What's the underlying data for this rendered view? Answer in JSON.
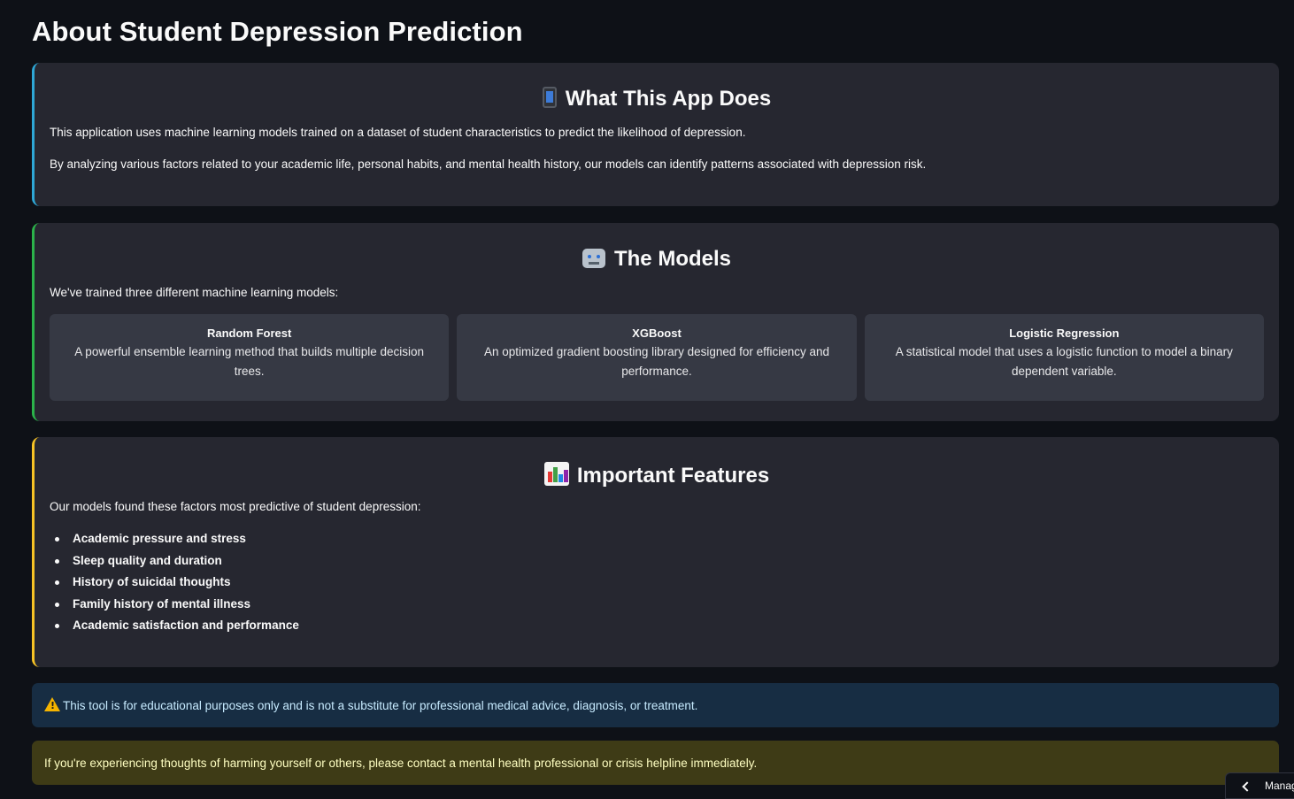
{
  "page": {
    "title": "About Student Depression Prediction"
  },
  "what_app_does": {
    "title": "What This App Does",
    "icon": "mobile-phone-icon",
    "paragraphs": [
      "This application uses machine learning models trained on a dataset of student characteristics to predict the likelihood of depression.",
      "By analyzing various factors related to your academic life, personal habits, and mental health history, our models can identify patterns associated with depression risk."
    ],
    "accent_color": "#2ea7d6"
  },
  "models": {
    "title": "The Models",
    "icon": "robot-icon",
    "intro": "We've trained three different machine learning models:",
    "accent_color": "#2bb34a",
    "items": [
      {
        "name": "Random Forest",
        "description": "A powerful ensemble learning method that builds multiple decision trees."
      },
      {
        "name": "XGBoost",
        "description": "An optimized gradient boosting library designed for efficiency and performance."
      },
      {
        "name": "Logistic Regression",
        "description": "A statistical model that uses a logistic function to model a binary dependent variable."
      }
    ]
  },
  "features": {
    "title": "Important Features",
    "icon": "bar-chart-icon",
    "intro": "Our models found these factors most predictive of student depression:",
    "accent_color": "#f7c325",
    "items": [
      "Academic pressure and stress",
      "Sleep quality and duration",
      "History of suicidal thoughts",
      "Family history of mental illness",
      "Academic satisfaction and performance"
    ]
  },
  "alerts": {
    "info": {
      "icon": "warning-icon",
      "text": "This tool is for educational purposes only and is not a substitute for professional medical advice, diagnosis, or treatment."
    },
    "warning": {
      "text": "If you're experiencing thoughts of harming yourself or others, please contact a mental health professional or crisis helpline immediately."
    }
  },
  "manage_app": {
    "label": "Manag",
    "icon": "chevron-left-icon"
  }
}
